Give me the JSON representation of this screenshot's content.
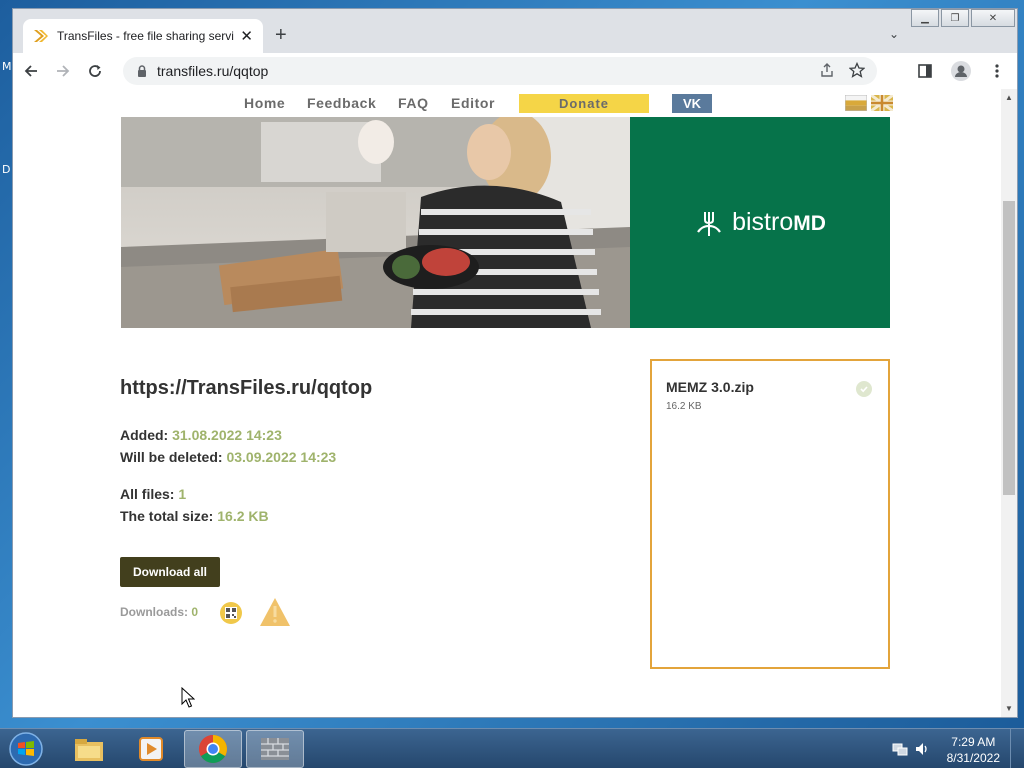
{
  "browser": {
    "tab_title": "TransFiles - free file sharing servi",
    "url": "transfiles.ru/qqtop",
    "window_controls": [
      "minimize",
      "restore",
      "close"
    ]
  },
  "site_nav": {
    "home": "Home",
    "feedback": "Feedback",
    "faq": "FAQ",
    "editor": "Editor",
    "donate": "Donate",
    "vk": "VK"
  },
  "banner": {
    "brand": "bistro",
    "brand_bold": "MD",
    "brand_color": "#06734a"
  },
  "share": {
    "title": "https://TransFiles.ru/qqtop",
    "added_label": "Added:",
    "added_value": "31.08.2022 14:23",
    "deleted_label": "Will be deleted:",
    "deleted_value": "03.09.2022 14:23",
    "files_label": "All files:",
    "files_value": "1",
    "size_label": "The total size:",
    "size_value": "16.2 KB",
    "download_all": "Download all",
    "downloads_label": "Downloads:",
    "downloads_value": "0"
  },
  "file_list": [
    {
      "name": "MEMZ 3.0.zip",
      "size": "16.2 KB"
    }
  ],
  "taskbar": {
    "time": "7:29 AM",
    "date": "8/31/2022"
  },
  "desktop": {
    "left_letters": [
      "M",
      "D"
    ]
  },
  "colors": {
    "accent_green": "#9fb36c",
    "donate_yellow": "#f5d547",
    "vk_blue": "#5a7a9c",
    "download_btn": "#423f1d",
    "file_card_border": "#e3a43b"
  }
}
